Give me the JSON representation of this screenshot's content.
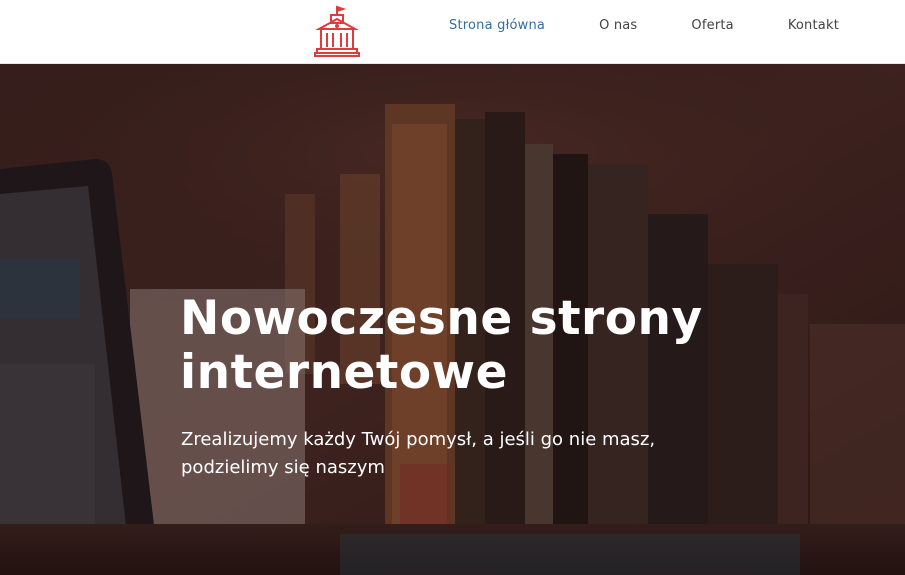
{
  "nav": {
    "logo_icon": "bank-building-icon",
    "brand_color": "#e03b3b",
    "active_color": "#2f6fa6",
    "items": [
      {
        "label": "Strona główna",
        "active": true
      },
      {
        "label": "O nas",
        "active": false
      },
      {
        "label": "Oferta",
        "active": false
      },
      {
        "label": "Kontakt",
        "active": false
      }
    ]
  },
  "hero": {
    "title": "Nowoczesne strony internetowe",
    "subtitle": "Zrealizujemy każdy Twój pomysł, a jeśli go nie masz, podzielimy się naszym",
    "background_icon": "desk-laptop-books-photo"
  }
}
